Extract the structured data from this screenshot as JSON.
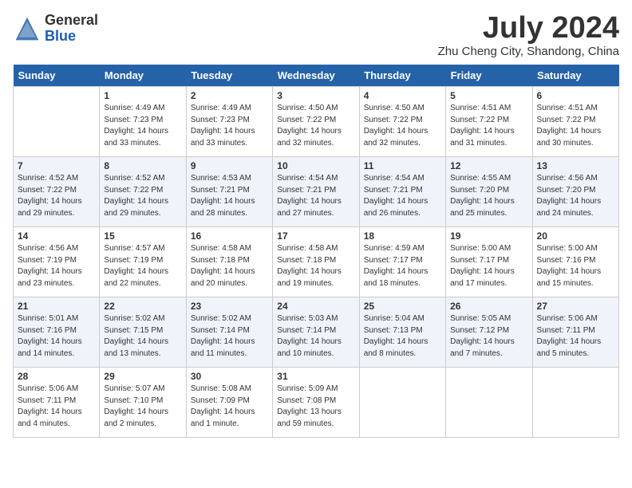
{
  "header": {
    "logo_general": "General",
    "logo_blue": "Blue",
    "month_year": "July 2024",
    "location": "Zhu Cheng City, Shandong, China"
  },
  "days_of_week": [
    "Sunday",
    "Monday",
    "Tuesday",
    "Wednesday",
    "Thursday",
    "Friday",
    "Saturday"
  ],
  "weeks": [
    [
      {
        "day": "",
        "info": ""
      },
      {
        "day": "1",
        "info": "Sunrise: 4:49 AM\nSunset: 7:23 PM\nDaylight: 14 hours\nand 33 minutes."
      },
      {
        "day": "2",
        "info": "Sunrise: 4:49 AM\nSunset: 7:23 PM\nDaylight: 14 hours\nand 33 minutes."
      },
      {
        "day": "3",
        "info": "Sunrise: 4:50 AM\nSunset: 7:22 PM\nDaylight: 14 hours\nand 32 minutes."
      },
      {
        "day": "4",
        "info": "Sunrise: 4:50 AM\nSunset: 7:22 PM\nDaylight: 14 hours\nand 32 minutes."
      },
      {
        "day": "5",
        "info": "Sunrise: 4:51 AM\nSunset: 7:22 PM\nDaylight: 14 hours\nand 31 minutes."
      },
      {
        "day": "6",
        "info": "Sunrise: 4:51 AM\nSunset: 7:22 PM\nDaylight: 14 hours\nand 30 minutes."
      }
    ],
    [
      {
        "day": "7",
        "info": "Sunrise: 4:52 AM\nSunset: 7:22 PM\nDaylight: 14 hours\nand 29 minutes."
      },
      {
        "day": "8",
        "info": "Sunrise: 4:52 AM\nSunset: 7:22 PM\nDaylight: 14 hours\nand 29 minutes."
      },
      {
        "day": "9",
        "info": "Sunrise: 4:53 AM\nSunset: 7:21 PM\nDaylight: 14 hours\nand 28 minutes."
      },
      {
        "day": "10",
        "info": "Sunrise: 4:54 AM\nSunset: 7:21 PM\nDaylight: 14 hours\nand 27 minutes."
      },
      {
        "day": "11",
        "info": "Sunrise: 4:54 AM\nSunset: 7:21 PM\nDaylight: 14 hours\nand 26 minutes."
      },
      {
        "day": "12",
        "info": "Sunrise: 4:55 AM\nSunset: 7:20 PM\nDaylight: 14 hours\nand 25 minutes."
      },
      {
        "day": "13",
        "info": "Sunrise: 4:56 AM\nSunset: 7:20 PM\nDaylight: 14 hours\nand 24 minutes."
      }
    ],
    [
      {
        "day": "14",
        "info": "Sunrise: 4:56 AM\nSunset: 7:19 PM\nDaylight: 14 hours\nand 23 minutes."
      },
      {
        "day": "15",
        "info": "Sunrise: 4:57 AM\nSunset: 7:19 PM\nDaylight: 14 hours\nand 22 minutes."
      },
      {
        "day": "16",
        "info": "Sunrise: 4:58 AM\nSunset: 7:18 PM\nDaylight: 14 hours\nand 20 minutes."
      },
      {
        "day": "17",
        "info": "Sunrise: 4:58 AM\nSunset: 7:18 PM\nDaylight: 14 hours\nand 19 minutes."
      },
      {
        "day": "18",
        "info": "Sunrise: 4:59 AM\nSunset: 7:17 PM\nDaylight: 14 hours\nand 18 minutes."
      },
      {
        "day": "19",
        "info": "Sunrise: 5:00 AM\nSunset: 7:17 PM\nDaylight: 14 hours\nand 17 minutes."
      },
      {
        "day": "20",
        "info": "Sunrise: 5:00 AM\nSunset: 7:16 PM\nDaylight: 14 hours\nand 15 minutes."
      }
    ],
    [
      {
        "day": "21",
        "info": "Sunrise: 5:01 AM\nSunset: 7:16 PM\nDaylight: 14 hours\nand 14 minutes."
      },
      {
        "day": "22",
        "info": "Sunrise: 5:02 AM\nSunset: 7:15 PM\nDaylight: 14 hours\nand 13 minutes."
      },
      {
        "day": "23",
        "info": "Sunrise: 5:02 AM\nSunset: 7:14 PM\nDaylight: 14 hours\nand 11 minutes."
      },
      {
        "day": "24",
        "info": "Sunrise: 5:03 AM\nSunset: 7:14 PM\nDaylight: 14 hours\nand 10 minutes."
      },
      {
        "day": "25",
        "info": "Sunrise: 5:04 AM\nSunset: 7:13 PM\nDaylight: 14 hours\nand 8 minutes."
      },
      {
        "day": "26",
        "info": "Sunrise: 5:05 AM\nSunset: 7:12 PM\nDaylight: 14 hours\nand 7 minutes."
      },
      {
        "day": "27",
        "info": "Sunrise: 5:06 AM\nSunset: 7:11 PM\nDaylight: 14 hours\nand 5 minutes."
      }
    ],
    [
      {
        "day": "28",
        "info": "Sunrise: 5:06 AM\nSunset: 7:11 PM\nDaylight: 14 hours\nand 4 minutes."
      },
      {
        "day": "29",
        "info": "Sunrise: 5:07 AM\nSunset: 7:10 PM\nDaylight: 14 hours\nand 2 minutes."
      },
      {
        "day": "30",
        "info": "Sunrise: 5:08 AM\nSunset: 7:09 PM\nDaylight: 14 hours\nand 1 minute."
      },
      {
        "day": "31",
        "info": "Sunrise: 5:09 AM\nSunset: 7:08 PM\nDaylight: 13 hours\nand 59 minutes."
      },
      {
        "day": "",
        "info": ""
      },
      {
        "day": "",
        "info": ""
      },
      {
        "day": "",
        "info": ""
      }
    ]
  ]
}
